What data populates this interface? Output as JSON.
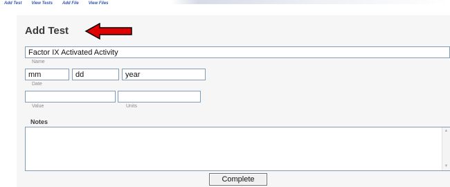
{
  "nav": {
    "items": [
      {
        "label": "Add Test"
      },
      {
        "label": "View Tests"
      },
      {
        "label": "Add File"
      },
      {
        "label": "View Files"
      }
    ]
  },
  "form": {
    "title": "Add Test",
    "name": {
      "value": "Factor IX Activated Activity",
      "label": "Name"
    },
    "date": {
      "month_value": "mm",
      "day_value": "dd",
      "year_value": "year",
      "label": "Date"
    },
    "value": {
      "value": "",
      "label": "Value"
    },
    "units": {
      "value": "",
      "label": "Units"
    },
    "notes": {
      "label": "Notes",
      "value": ""
    },
    "complete_label": "Complete"
  },
  "colors": {
    "arrow": "#e00000",
    "input_border": "#7f9db9",
    "nav_link": "#3355aa"
  },
  "icons": {
    "arrow": "red-left-arrow-icon",
    "scroll_up": "scroll-up-icon",
    "scroll_down": "scroll-down-icon"
  }
}
